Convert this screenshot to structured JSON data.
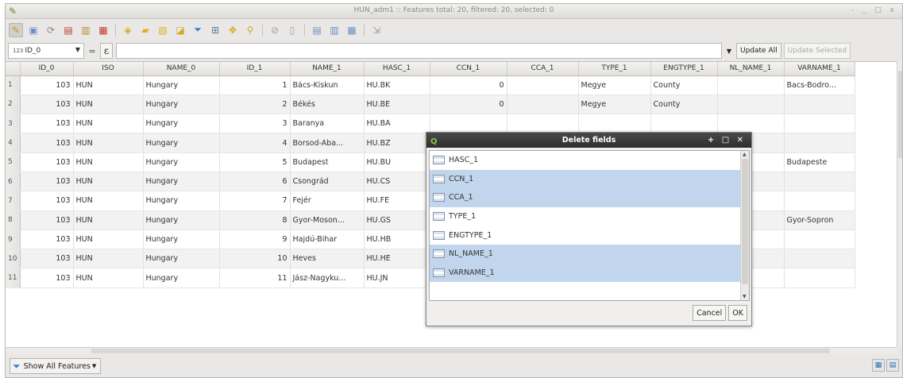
{
  "window": {
    "title": "HUN_adm1 :: Features total: 20, filtered: 20, selected: 0",
    "app_icon": "qgis-icon",
    "controls": "- _ □ x"
  },
  "toolbar": {
    "icons": [
      "edit-pencil-icon",
      "save-edits-icon",
      "reload-icon",
      "delete-feature-icon",
      "new-field-icon",
      "delete-field-icon",
      "copy-row-icon",
      "paste-icon",
      "select-all-icon",
      "invert-selection-icon",
      "filter-icon",
      "move-selection-top-icon",
      "pan-to-selection-icon",
      "zoom-to-selection-icon",
      "copy-icon",
      "paste-features-icon",
      "dock-table-icon",
      "field-calculator-icon",
      "expand-icon"
    ]
  },
  "calc": {
    "field": "ID_0",
    "field_type_badge": "123",
    "eq_symbol": "=",
    "expr_symbol": "ε",
    "update_all": "Update All",
    "update_selected": "Update Selected"
  },
  "table": {
    "columns": [
      "ID_0",
      "ISO",
      "NAME_0",
      "ID_1",
      "NAME_1",
      "HASC_1",
      "CCN_1",
      "CCA_1",
      "TYPE_1",
      "ENGTYPE_1",
      "NL_NAME_1",
      "VARNAME_1"
    ],
    "rows": [
      [
        "1",
        "103",
        "HUN",
        "Hungary",
        "1",
        "Bács-Kiskun",
        "HU.BK",
        "0",
        "",
        "Megye",
        "County",
        "",
        "Bacs-Bodro..."
      ],
      [
        "2",
        "103",
        "HUN",
        "Hungary",
        "2",
        "Békés",
        "HU.BE",
        "0",
        "",
        "Megye",
        "County",
        "",
        ""
      ],
      [
        "3",
        "103",
        "HUN",
        "Hungary",
        "3",
        "Baranya",
        "HU.BA",
        "",
        "",
        "",
        "",
        "",
        ""
      ],
      [
        "4",
        "103",
        "HUN",
        "Hungary",
        "4",
        "Borsod-Aba...",
        "HU.BZ",
        "",
        "",
        "",
        "",
        "",
        ""
      ],
      [
        "5",
        "103",
        "HUN",
        "Hungary",
        "5",
        "Budapest",
        "HU.BU",
        "",
        "",
        "",
        "",
        "",
        "Budapeste"
      ],
      [
        "6",
        "103",
        "HUN",
        "Hungary",
        "6",
        "Csongrád",
        "HU.CS",
        "",
        "",
        "",
        "",
        "",
        ""
      ],
      [
        "7",
        "103",
        "HUN",
        "Hungary",
        "7",
        "Fejér",
        "HU.FE",
        "",
        "",
        "",
        "",
        "",
        ""
      ],
      [
        "8",
        "103",
        "HUN",
        "Hungary",
        "8",
        "Gyor-Moson...",
        "HU.GS",
        "",
        "",
        "",
        "",
        "",
        "Gyor-Sopron"
      ],
      [
        "9",
        "103",
        "HUN",
        "Hungary",
        "9",
        "Hajdú-Bihar",
        "HU.HB",
        "",
        "",
        "",
        "",
        "",
        ""
      ],
      [
        "10",
        "103",
        "HUN",
        "Hungary",
        "10",
        "Heves",
        "HU.HE",
        "",
        "",
        "",
        "",
        "",
        ""
      ],
      [
        "11",
        "103",
        "HUN",
        "Hungary",
        "11",
        "Jász-Nagyku...",
        "HU.JN",
        "",
        "",
        "",
        "",
        "",
        ""
      ]
    ]
  },
  "bottom": {
    "show_all": "Show All Features",
    "show_all_icon": "funnel-icon"
  },
  "dialog": {
    "title": "Delete fields",
    "title_icon": "qgis-q-icon",
    "controls": "+ □ ✕",
    "fields": [
      {
        "label": "HASC_1",
        "selected": false
      },
      {
        "label": "CCN_1",
        "selected": true
      },
      {
        "label": "CCA_1",
        "selected": true
      },
      {
        "label": "TYPE_1",
        "selected": false
      },
      {
        "label": "ENGTYPE_1",
        "selected": false
      },
      {
        "label": "NL_NAME_1",
        "selected": true
      },
      {
        "label": "VARNAME_1",
        "selected": true
      }
    ],
    "cancel": "Cancel",
    "ok": "OK"
  },
  "colors": {
    "selection": "#c1d6ec",
    "dialog_title_bg": "#2e2e2e",
    "window_bg": "#e9e8e6"
  }
}
